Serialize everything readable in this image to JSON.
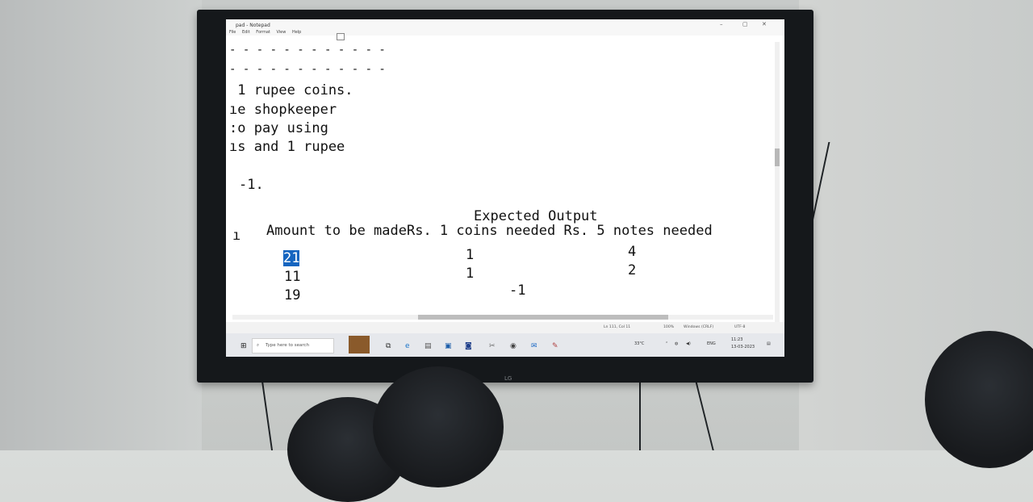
{
  "notepad": {
    "title": "pad - Notepad",
    "menu": [
      "File",
      "Edit",
      "Format",
      "View",
      "Help"
    ],
    "controls": {
      "minimize": "–",
      "maximize": "▢",
      "close": "✕"
    },
    "lines": [
      "- - - - - - - - - - - -",
      "- - - - - - - - - - - -",
      " 1 rupee coins.",
      "ıe shopkeeper",
      ":o pay using",
      "ıs and 1 rupee",
      "-1.",
      "Expected Output",
      "Amount to be madeRs. 1 coins needed Rs. 5 notes needed"
    ],
    "prefix_marker": "ı",
    "table": {
      "amounts": [
        "21",
        "11",
        "19"
      ],
      "coins": [
        "1",
        "1"
      ],
      "notes": [
        "4",
        "2"
      ],
      "combined": "-1"
    },
    "status": {
      "position": "Ln 111, Col 11",
      "zoom": "100%",
      "line_ending": "Windows (CRLF)",
      "encoding": "UTF-8"
    }
  },
  "taskbar": {
    "search_placeholder": "Type here to search",
    "temperature": "33°C",
    "language": "ENG",
    "time": "11:23",
    "date": "13-03-2023"
  },
  "tv": {
    "brand": "LG"
  },
  "colors": {
    "selection": "#1565c0",
    "screen_bg": "#ffffff",
    "taskbar_bg": "#e6e8ec"
  }
}
